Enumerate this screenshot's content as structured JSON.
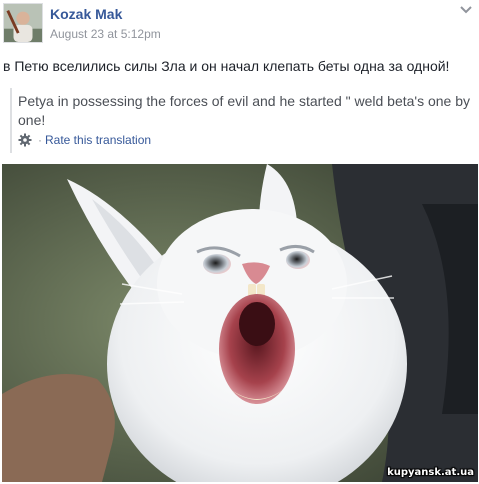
{
  "post": {
    "author": "Kozak Mak",
    "timestamp": "August 23 at 5:12pm",
    "text": "в Петю вселились силы Зла и он начал клепать беты одна за одной!",
    "menu_icon": "chevron-down-icon"
  },
  "translation": {
    "text": "Petya in possessing the forces of evil and he started \" weld beta's one by one!",
    "rate_separator": "·",
    "rate_label": "Rate this translation",
    "rate_icon": "gear-icon"
  },
  "photo": {
    "watermark": "kupyansk.at.ua"
  },
  "colors": {
    "link": "#365899",
    "meta": "#90949c",
    "text": "#1d2129",
    "translation_text": "#4b4f56"
  }
}
